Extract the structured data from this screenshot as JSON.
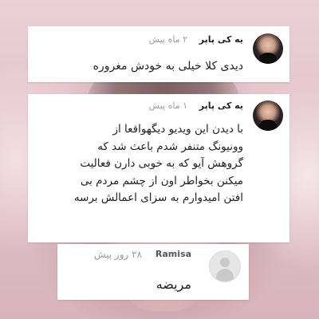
{
  "comments": [
    {
      "author": "یه کی پاپر",
      "time": "۲ ماه پیش",
      "lines": [
        "دیدی کلا خیلی به خودش مغروره"
      ]
    },
    {
      "author": "یه کی پاپر",
      "time": "۱ ماه پیش",
      "lines": [
        "با دیدن این ویدیو دیگهواقعا از",
        "وونیونگ متنفر شدم باعث شد که",
        "گروهش آیو که به خوبی دارن فعالیت",
        "میکنن بخواطر اون از چشم مردم بی",
        "افتن امیدوارم به سزای اعمالش برسه"
      ]
    },
    {
      "author": "Ramisa",
      "time": "۲۸ روز پیش",
      "lines": [
        "مریضه"
      ]
    }
  ]
}
